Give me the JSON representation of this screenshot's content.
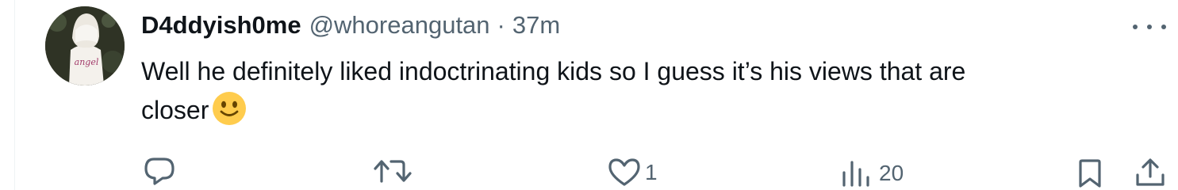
{
  "tweet": {
    "display_name": "D4ddyish0me",
    "handle": "@whoreangutan",
    "separator": "·",
    "time": "37m",
    "text_line1": "Well he definitely liked indoctrinating kids so I guess it’s his views that are",
    "text_line2": "closer",
    "emoji": "slightly-smiling-face",
    "avatar_text": "angel"
  },
  "actions": {
    "reply_icon": "reply-icon",
    "retweet_icon": "retweet-icon",
    "like_icon": "heart-icon",
    "like_count": "1",
    "views_icon": "views-icon",
    "views_count": "20",
    "bookmark_icon": "bookmark-icon",
    "share_icon": "share-icon"
  },
  "colors": {
    "text": "#0f1419",
    "secondary": "#536471",
    "emoji": "#ffcc4d"
  }
}
